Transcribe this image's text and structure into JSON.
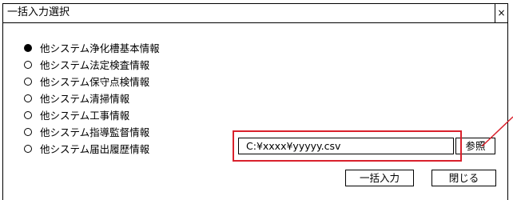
{
  "dialog": {
    "title": "一括入力選択",
    "close_glyph": "×"
  },
  "options": [
    {
      "label": "他システム浄化槽基本情報",
      "selected": true
    },
    {
      "label": "他システム法定検査情報",
      "selected": false
    },
    {
      "label": "他システム保守点検情報",
      "selected": false
    },
    {
      "label": "他システム清掃情報",
      "selected": false
    },
    {
      "label": "他システム工事情報",
      "selected": false
    },
    {
      "label": "他システム指導監督情報",
      "selected": false
    },
    {
      "label": "他システム届出履歴情報",
      "selected": false
    }
  ],
  "file": {
    "path_value": "C:¥xxxx¥yyyyy.csv",
    "browse_label": "参照"
  },
  "buttons": {
    "import_label": "一括入力",
    "close_label": "閉じる"
  },
  "colors": {
    "highlight": "#d9212c"
  }
}
